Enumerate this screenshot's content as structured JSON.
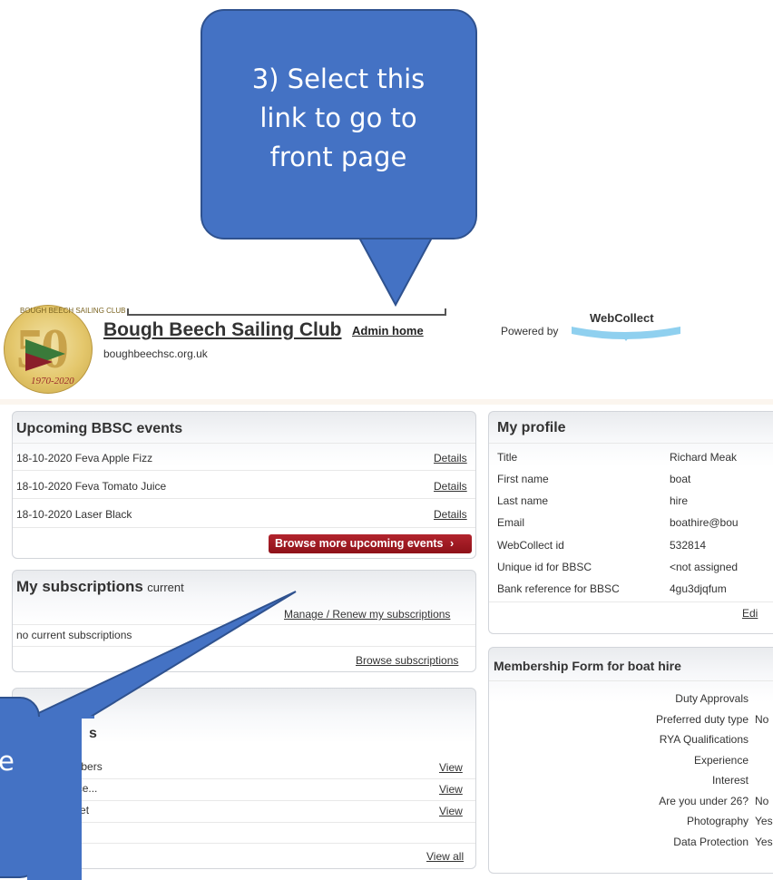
{
  "header": {
    "club_name": "Bough Beech Sailing Club",
    "admin_home": "Admin home",
    "club_url": "boughbeechsc.org.uk",
    "powered_by": "Powered by",
    "webcollect": "WebCollect",
    "logo_years": "1970-2020",
    "logo_fifty": "50",
    "logo_arc": "BOUGH BEECH SAILING CLUB"
  },
  "events": {
    "title": "Upcoming BBSC events",
    "items": [
      {
        "name": "18-10-2020 Feva Apple Fizz",
        "link": "Details"
      },
      {
        "name": "18-10-2020 Feva Tomato Juice",
        "link": "Details"
      },
      {
        "name": "18-10-2020 Laser Black",
        "link": "Details"
      }
    ],
    "browse_button": "Browse more upcoming events"
  },
  "subscriptions": {
    "title": "My subscriptions",
    "title_suffix": "current",
    "manage_link": "Manage / Renew my subscriptions",
    "empty_text": "no current subscriptions",
    "browse_link": "Browse subscriptions"
  },
  "lists": {
    "title_partial": "s",
    "items": [
      {
        "name": "20 Members",
        "link": "View"
      },
      {
        "name": "tant Race...",
        "link": "View"
      },
      {
        "name": "icap Fleet",
        "link": "View"
      },
      {
        "name": "...",
        "link": ""
      }
    ],
    "view_all": "View all"
  },
  "profile": {
    "title": "My profile",
    "rows": [
      {
        "label": "Title",
        "value": "Richard Meak"
      },
      {
        "label": "First name",
        "value": "boat"
      },
      {
        "label": "Last name",
        "value": "hire"
      },
      {
        "label": "Email",
        "value": "boathire@bou"
      },
      {
        "label": "WebCollect id",
        "value": "532814"
      },
      {
        "label": "Unique id for BBSC",
        "value": "<not assigned"
      },
      {
        "label": "Bank reference for BBSC",
        "value": "4gu3djqfum"
      }
    ],
    "edit": "Edi"
  },
  "membership_form": {
    "title": "Membership Form for boat hire",
    "rows": [
      {
        "label": "Duty Approvals",
        "value": ""
      },
      {
        "label": "Preferred duty type",
        "value": "No"
      },
      {
        "label": "RYA Qualifications",
        "value": ""
      },
      {
        "label": "Experience",
        "value": ""
      },
      {
        "label": "Interest",
        "value": ""
      },
      {
        "label": "Are you under 26?",
        "value": "No"
      },
      {
        "label": "Photography",
        "value": "Yes"
      },
      {
        "label": "Data Protection",
        "value": "Yes"
      }
    ]
  },
  "callouts": {
    "top_text": "3) Select this link to go to front page",
    "left_text": "e"
  },
  "colors": {
    "callout_fill": "#4472c4",
    "browse_button": "#a51a24"
  }
}
